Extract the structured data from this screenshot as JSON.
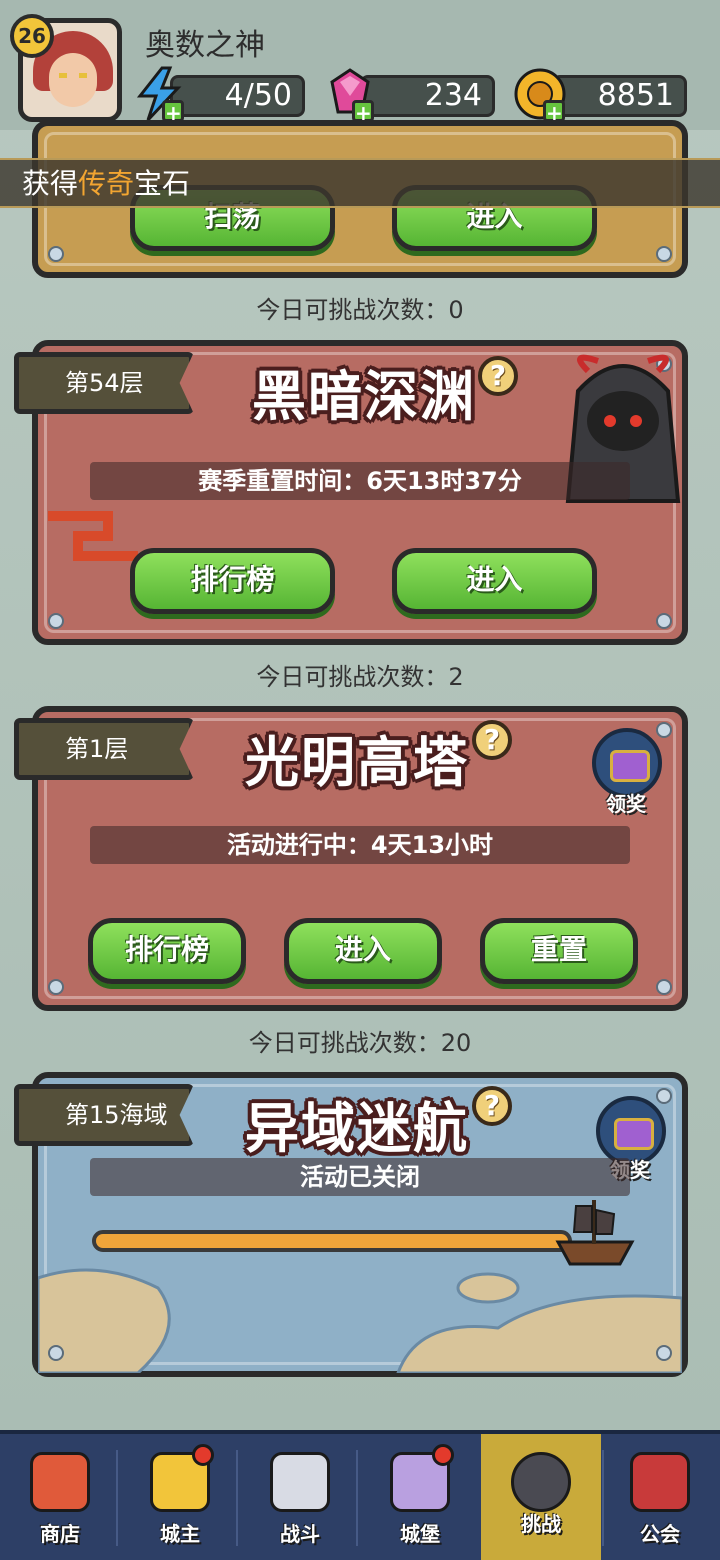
{
  "player": {
    "level": "26",
    "name": "奥数之神"
  },
  "resources": {
    "energy": "4/50",
    "gems": "234",
    "gold": "8851"
  },
  "notice": {
    "prefix": "获得",
    "highlight": "传奇",
    "suffix": "宝石"
  },
  "top_card": {
    "button_sweep": "扫荡",
    "button_enter": "进入",
    "count_text": "今日可挑战次数：0"
  },
  "abyss": {
    "floor": "第54层",
    "title": "黑暗深渊",
    "help": "?",
    "info": "赛季重置时间：6天13时37分",
    "button_rank": "排行榜",
    "button_enter": "进入",
    "count_text": "今日可挑战次数：2"
  },
  "tower": {
    "floor": "第1层",
    "title": "光明高塔",
    "help": "?",
    "reward_label": "领奖",
    "info": "活动进行中：4天13小时",
    "button_rank": "排行榜",
    "button_enter": "进入",
    "button_reset": "重置",
    "count_text": "今日可挑战次数：20"
  },
  "voyage": {
    "floor": "第15海域",
    "title": "异域迷航",
    "help": "?",
    "reward_label": "领奖",
    "info": "活动已关闭",
    "progress": 1.0
  },
  "nav": [
    {
      "label": "商店",
      "icon": "shop-icon"
    },
    {
      "label": "城主",
      "icon": "crown-icon"
    },
    {
      "label": "战斗",
      "icon": "swords-icon"
    },
    {
      "label": "城堡",
      "icon": "castle-icon"
    },
    {
      "label": "挑战",
      "icon": "demon-icon"
    },
    {
      "label": "公会",
      "icon": "guild-banner-icon"
    }
  ],
  "colors": {
    "button_green": "#6ccf45",
    "nav_bg": "#2d3f66",
    "active_tab": "#c9aa3a",
    "highlight_orange": "#f2a531"
  }
}
